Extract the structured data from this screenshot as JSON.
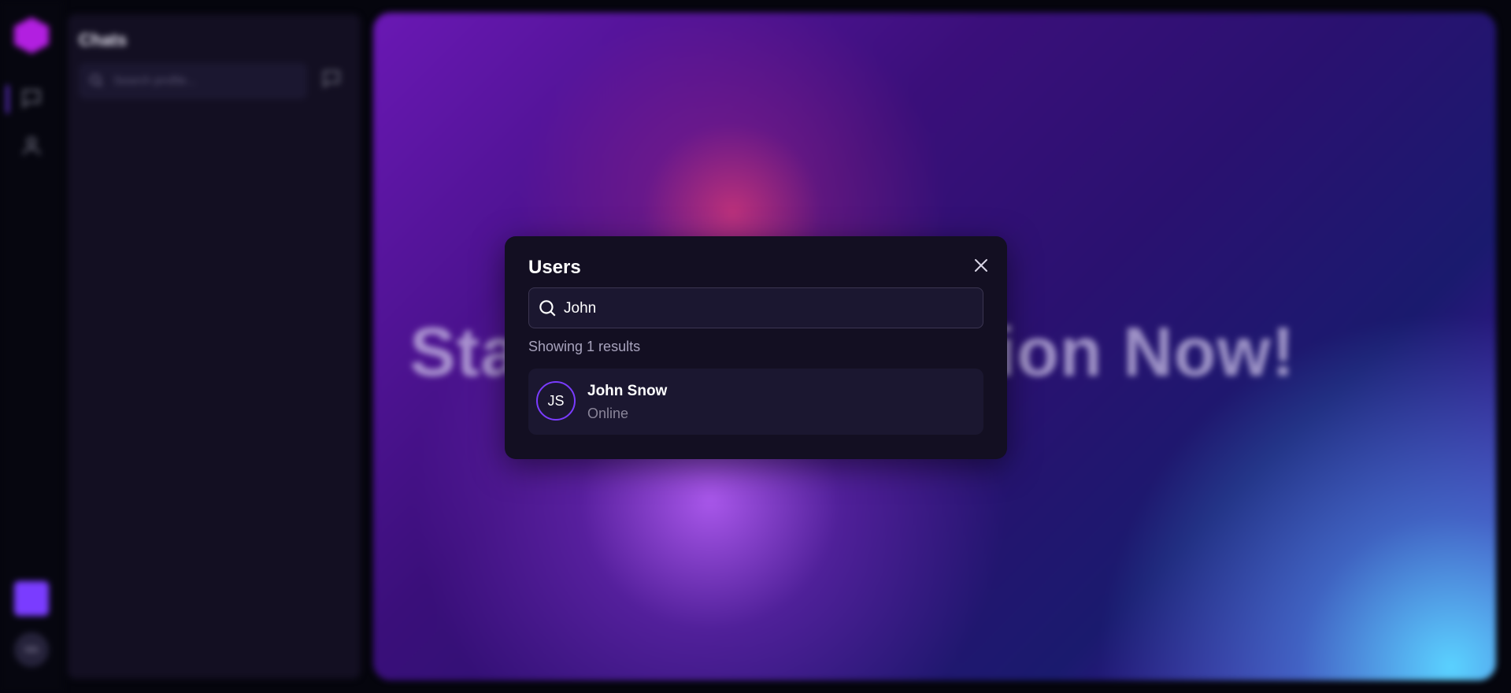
{
  "rail": {
    "avatar_initials": "NN"
  },
  "chats_panel": {
    "title": "Chats",
    "search_placeholder": "Search profile..."
  },
  "hero": {
    "headline": "Start a Conversation Now!"
  },
  "modal": {
    "title": "Users",
    "search_value": "John",
    "results_text": "Showing 1 results",
    "results": [
      {
        "initials": "JS",
        "name": "John Snow",
        "status": "Online"
      }
    ]
  },
  "colors": {
    "accent": "#7a3cff",
    "modal_bg": "#130f22",
    "field_bg": "#1b1730"
  }
}
